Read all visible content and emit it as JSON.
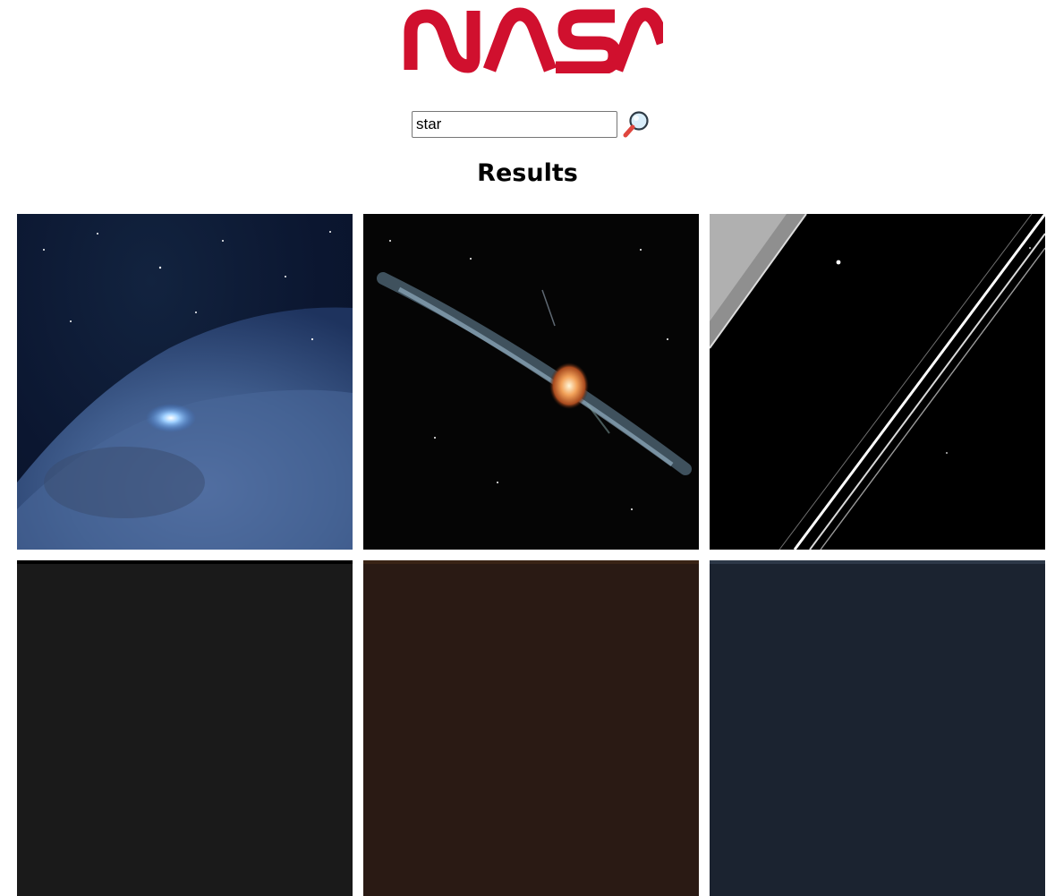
{
  "header": {
    "logo_name": "NASA",
    "logo_color": "#d0102e"
  },
  "search": {
    "value": "star",
    "button_icon": "magnifying-glass-icon"
  },
  "results": {
    "title": "Results",
    "items": [
      {
        "icon": "nebula-image"
      },
      {
        "icon": "star-disk-image"
      },
      {
        "icon": "saturn-rings-image"
      },
      {
        "icon": "result-image"
      },
      {
        "icon": "result-image"
      },
      {
        "icon": "result-image"
      }
    ]
  }
}
